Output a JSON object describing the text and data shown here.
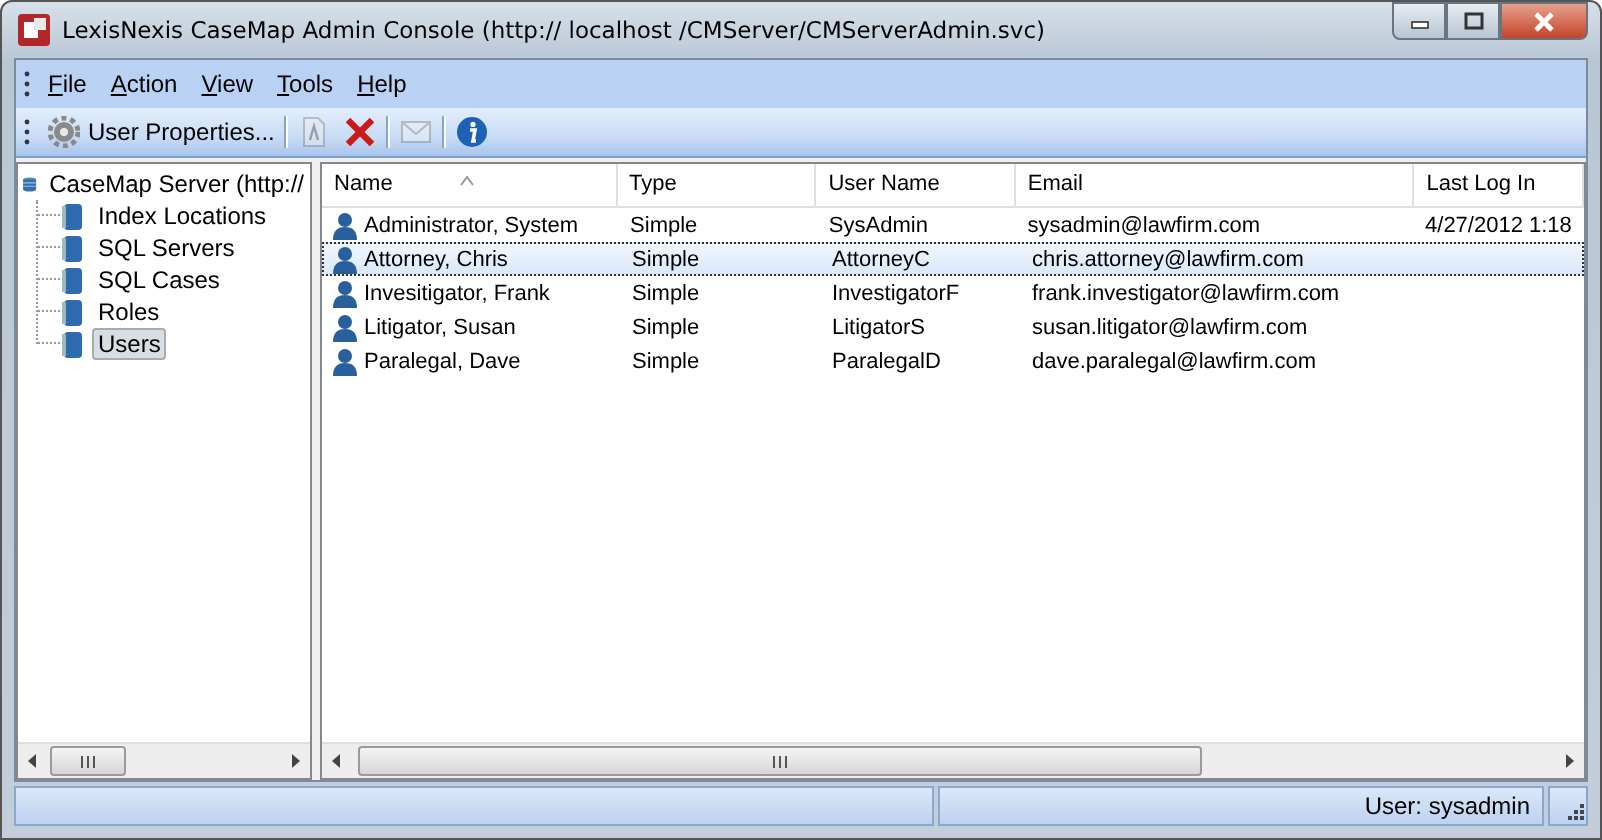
{
  "window": {
    "title": "LexisNexis CaseMap Admin Console (http:// localhost /CMServer/CMServerAdmin.svc)"
  },
  "menu": [
    {
      "label": "File"
    },
    {
      "label": "Action"
    },
    {
      "label": "View"
    },
    {
      "label": "Tools"
    },
    {
      "label": "Help"
    }
  ],
  "toolbar": [
    {
      "kind": "properties",
      "label": "User Properties...",
      "disabled": false
    },
    {
      "kind": "separator"
    },
    {
      "kind": "new",
      "disabled": true
    },
    {
      "kind": "delete",
      "disabled": false
    },
    {
      "kind": "separator"
    },
    {
      "kind": "mail",
      "disabled": true
    },
    {
      "kind": "separator"
    },
    {
      "kind": "info",
      "disabled": false
    }
  ],
  "tree": {
    "label": "CaseMap Server (http://",
    "children": [
      {
        "label": "Index Locations",
        "selected": false
      },
      {
        "label": "SQL Servers",
        "selected": false
      },
      {
        "label": "SQL Cases",
        "selected": false
      },
      {
        "label": "Roles",
        "selected": false
      },
      {
        "label": "Users",
        "selected": true
      }
    ]
  },
  "table": {
    "columns": [
      {
        "label": "Name",
        "sorted": true
      },
      {
        "label": "Type",
        "sorted": false
      },
      {
        "label": "User Name",
        "sorted": false
      },
      {
        "label": "Email",
        "sorted": false
      },
      {
        "label": "Last Log In",
        "sorted": false
      }
    ],
    "rows": [
      {
        "cells": [
          "Administrator, System",
          "Simple",
          "SysAdmin",
          "sysadmin@lawfirm.com",
          "4/27/2012 1:18"
        ],
        "selected": false
      },
      {
        "cells": [
          "Attorney, Chris",
          "Simple",
          "AttorneyC",
          "chris.attorney@lawfirm.com"
        ],
        "selected": true
      },
      {
        "cells": [
          "Invesitigator, Frank",
          "Simple",
          "InvestigatorF",
          "frank.investigator@lawfirm.com"
        ],
        "selected": false
      },
      {
        "cells": [
          "Litigator, Susan",
          "Simple",
          "LitigatorS",
          "susan.litigator@lawfirm.com"
        ],
        "selected": false
      },
      {
        "cells": [
          "Paralegal, Dave",
          "Simple",
          "ParalegalD",
          "dave.paralegal@lawfirm.com"
        ],
        "selected": false
      }
    ]
  },
  "status_bar": {
    "user": "User: sysadmin"
  }
}
